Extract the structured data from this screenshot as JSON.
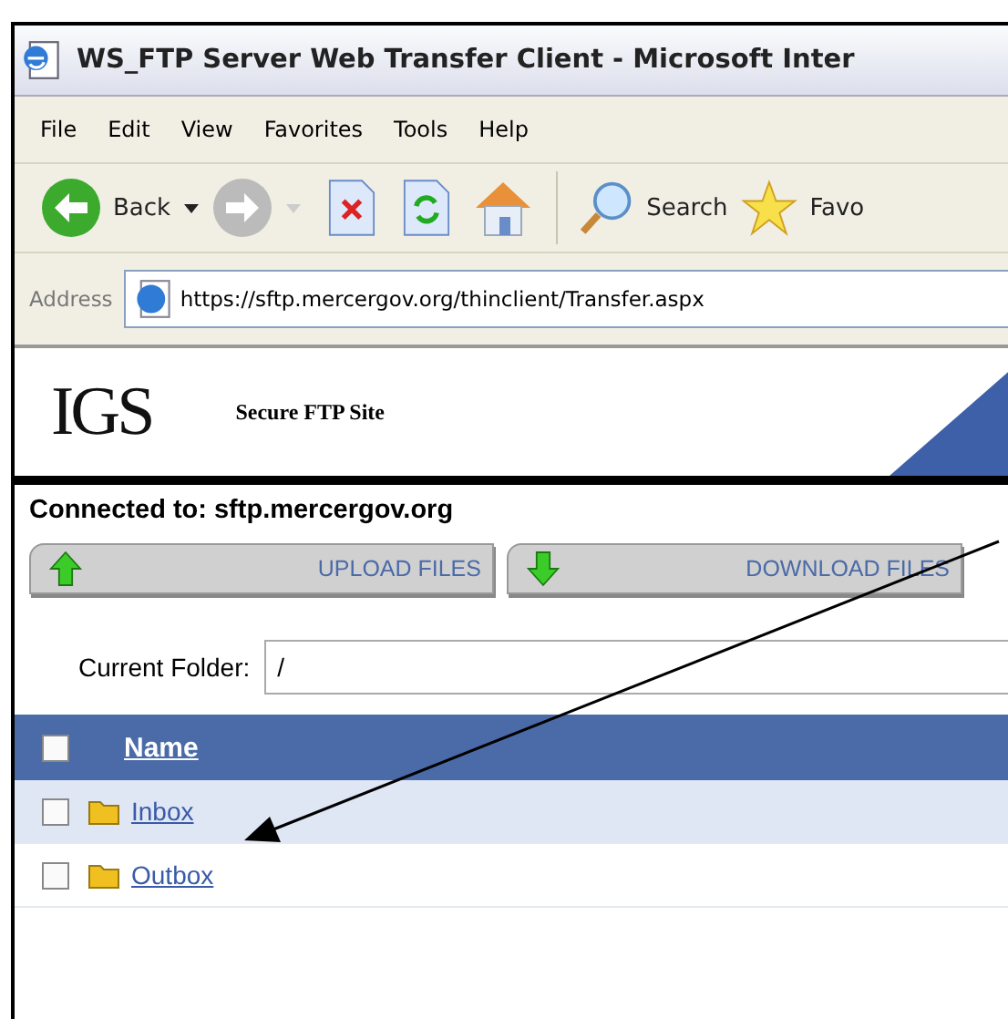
{
  "window": {
    "title": "WS_FTP Server Web Transfer Client - Microsoft Inter"
  },
  "menu": [
    "File",
    "Edit",
    "View",
    "Favorites",
    "Tools",
    "Help"
  ],
  "toolbar": {
    "back": "Back",
    "search": "Search",
    "favorites": "Favo"
  },
  "address": {
    "label": "Address",
    "url": "https://sftp.mercergov.org/thinclient/Transfer.aspx"
  },
  "banner": {
    "logo": "IGS",
    "site": "Secure FTP Site"
  },
  "connected": "Connected to: sftp.mercergov.org",
  "buttons": [
    {
      "kind": "upload",
      "label": "UPLOAD FILES"
    },
    {
      "kind": "download",
      "label": "DOWNLOAD FILES"
    }
  ],
  "folder": {
    "label": "Current Folder:",
    "value": "/"
  },
  "table": {
    "header": {
      "checked": false,
      "name": "Name"
    },
    "rows": [
      {
        "name": "Inbox",
        "checked": false
      },
      {
        "name": "Outbox",
        "checked": false
      }
    ]
  }
}
